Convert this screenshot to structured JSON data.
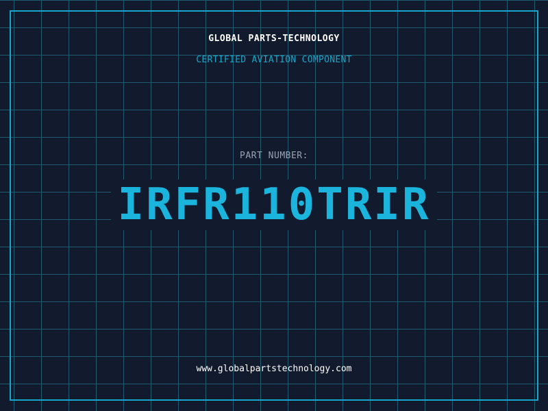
{
  "header": {
    "brand": "GLOBAL PARTS-TECHNOLOGY",
    "subtitle": "CERTIFIED AVIATION COMPONENT"
  },
  "part": {
    "label": "PART NUMBER:",
    "number": "IRFR110TRIR"
  },
  "footer": {
    "url": "www.globalpartstechnology.com"
  },
  "colors": {
    "background": "#121a2e",
    "accent": "#1aa6c8",
    "part_number": "#1ab4dc",
    "grid": "#1f5a6e",
    "label": "#9aa3b3",
    "text": "#ffffff"
  }
}
